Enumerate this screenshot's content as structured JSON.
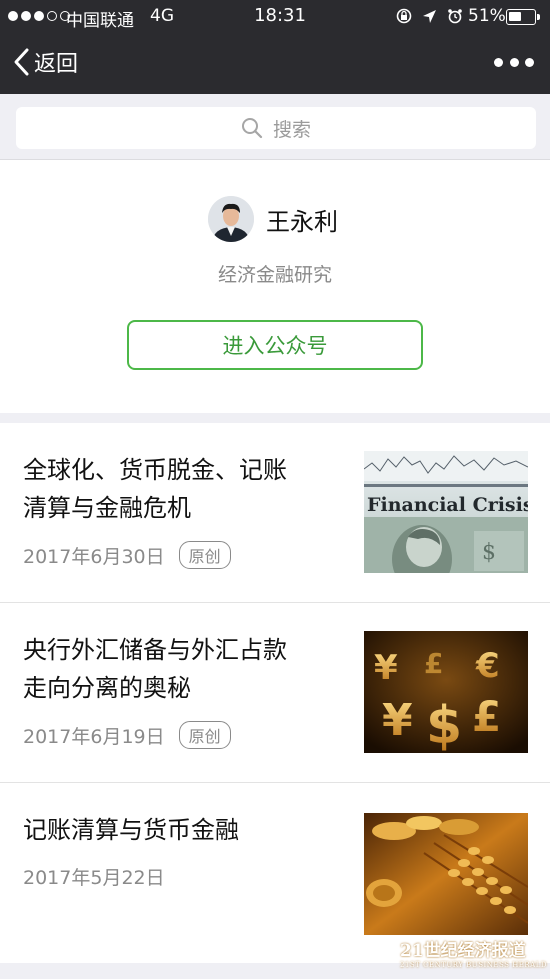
{
  "status_bar": {
    "carrier": "中国联通",
    "network": "4G",
    "time": "18:31",
    "battery": "51%",
    "battery_level": 0.51,
    "signal_bars": 3,
    "signal_total": 5
  },
  "nav": {
    "back_label": "返回"
  },
  "search": {
    "placeholder": "搜索"
  },
  "account": {
    "name": "王永利",
    "description": "经济金融研究",
    "enter_label": "进入公众号"
  },
  "articles": [
    {
      "title_line1": "全球化、货币脱金、记账",
      "title_line2": "清算与金融危机",
      "date": "2017年6月30日",
      "badge": "原创",
      "thumb_text": "Financial Crisis",
      "thumb_icon": "financial-crisis-dollar-image"
    },
    {
      "title_line1": "央行外汇储备与外汇占款",
      "title_line2": "走向分离的奥秘",
      "date": "2017年6月19日",
      "badge": "原创",
      "thumb_icon": "currency-symbols-image"
    },
    {
      "title_line1": "记账清算与货币金融",
      "title_line2": "",
      "date": "2017年5月22日",
      "badge": "",
      "thumb_icon": "gold-coins-abacus-image"
    }
  ],
  "watermark": {
    "text": "21世纪经济报道",
    "sub": "21ST CENTURY BUSINESS HERALD"
  },
  "colors": {
    "nav_bg": "#2b2b2f",
    "accent_green": "#4cb848",
    "page_bg": "#efeff4"
  }
}
